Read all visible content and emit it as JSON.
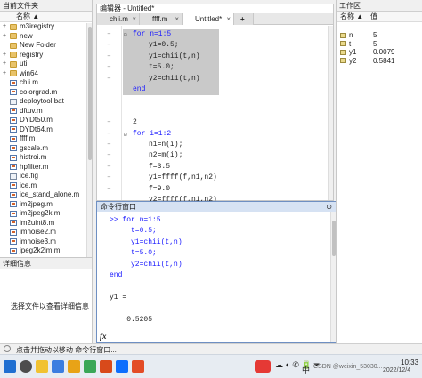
{
  "left_panel": {
    "title": "当前文件夹",
    "column_header": "名称 ▲",
    "items": [
      {
        "name": "m3iregistry",
        "type": "folder",
        "expander": "+"
      },
      {
        "name": "new",
        "type": "folder",
        "expander": "+"
      },
      {
        "name": "New Folder",
        "type": "folder",
        "expander": ""
      },
      {
        "name": "registry",
        "type": "folder",
        "expander": "+"
      },
      {
        "name": "util",
        "type": "folder",
        "expander": "+"
      },
      {
        "name": "win64",
        "type": "folder",
        "expander": "+"
      },
      {
        "name": "chii.m",
        "type": "m"
      },
      {
        "name": "colorgrad.m",
        "type": "m"
      },
      {
        "name": "deploytool.bat",
        "type": "other"
      },
      {
        "name": "dftuv.m",
        "type": "m"
      },
      {
        "name": "DYDt50.m",
        "type": "m"
      },
      {
        "name": "DYDt64.m",
        "type": "m"
      },
      {
        "name": "ffff.m",
        "type": "m"
      },
      {
        "name": "gscale.m",
        "type": "m"
      },
      {
        "name": "histroi.m",
        "type": "m"
      },
      {
        "name": "hpfilter.m",
        "type": "m"
      },
      {
        "name": "ice.fig",
        "type": "other"
      },
      {
        "name": "ice.m",
        "type": "m"
      },
      {
        "name": "ice_stand_alone.m",
        "type": "m"
      },
      {
        "name": "im2jpeg.m",
        "type": "m"
      },
      {
        "name": "im2jpeg2k.m",
        "type": "m"
      },
      {
        "name": "im2uint8.m",
        "type": "m"
      },
      {
        "name": "imnoise2.m",
        "type": "m"
      },
      {
        "name": "imnoise3.m",
        "type": "m"
      },
      {
        "name": "jpeg2k2im.m",
        "type": "m"
      }
    ]
  },
  "details": {
    "title": "详细信息",
    "placeholder": "选择文件以查看详细信息"
  },
  "editor": {
    "title": "编辑器 - Untitled*",
    "tabs": [
      {
        "label": "chii.m",
        "active": false
      },
      {
        "label": "ffff.m",
        "active": false
      },
      {
        "label": "Untitled*",
        "active": true
      }
    ],
    "add_tab": "+",
    "gutter_marks": [
      "–",
      "–",
      "–",
      "–",
      "–",
      "",
      "",
      "",
      "–",
      "–",
      "–",
      "–",
      "–",
      "–",
      "–"
    ],
    "lines": [
      {
        "text": "for n=1:5",
        "kw": "for",
        "indent": 0
      },
      {
        "text": "y1=0.5;",
        "indent": 1
      },
      {
        "text": "y1=chii(t,n)",
        "indent": 1
      },
      {
        "text": "t=5.0;",
        "indent": 1
      },
      {
        "text": "y2=chii(t,n)",
        "indent": 1
      },
      {
        "text": "end",
        "kw": "end",
        "indent": 0
      },
      {
        "text": "",
        "indent": 0
      },
      {
        "text": "",
        "indent": 0
      },
      {
        "text": "2",
        "indent": 0
      },
      {
        "text": "for i=1:2",
        "kw": "for",
        "indent": 0
      },
      {
        "text": "n1=n(i);",
        "indent": 1
      },
      {
        "text": "n2=m(i);",
        "indent": 1
      },
      {
        "text": "f=3.5",
        "indent": 1
      },
      {
        "text": "y1=ffff(f,n1,n2)",
        "indent": 1
      },
      {
        "text": "f=9.0",
        "indent": 1
      },
      {
        "text": "y2=ffff(f,n1,n2)",
        "indent": 1
      }
    ]
  },
  "command_window": {
    "title": "命令行窗口",
    "lines": [
      ">> for n=1:5",
      "     t=0.5;",
      "     y1=chii(t,n)",
      "     t=5.0;",
      "     y2=chii(t,n)",
      "end",
      "",
      "y1 =",
      "",
      "    0.5205"
    ],
    "prompt_icon": "fx"
  },
  "workspace": {
    "title": "工作区",
    "col_name": "名称 ▲",
    "col_value": "值",
    "vars": [
      {
        "name": "n",
        "value": "5"
      },
      {
        "name": "t",
        "value": "5"
      },
      {
        "name": "y1",
        "value": "0.0079"
      },
      {
        "name": "y2",
        "value": "0.5841"
      }
    ]
  },
  "status_bar": {
    "text": "点击并拖动以移动 命令行窗口..."
  },
  "taskbar": {
    "input_method": "中",
    "time": "10:33",
    "date": "2022/12/4",
    "watermark": "CSDN @weixin_53030..."
  }
}
